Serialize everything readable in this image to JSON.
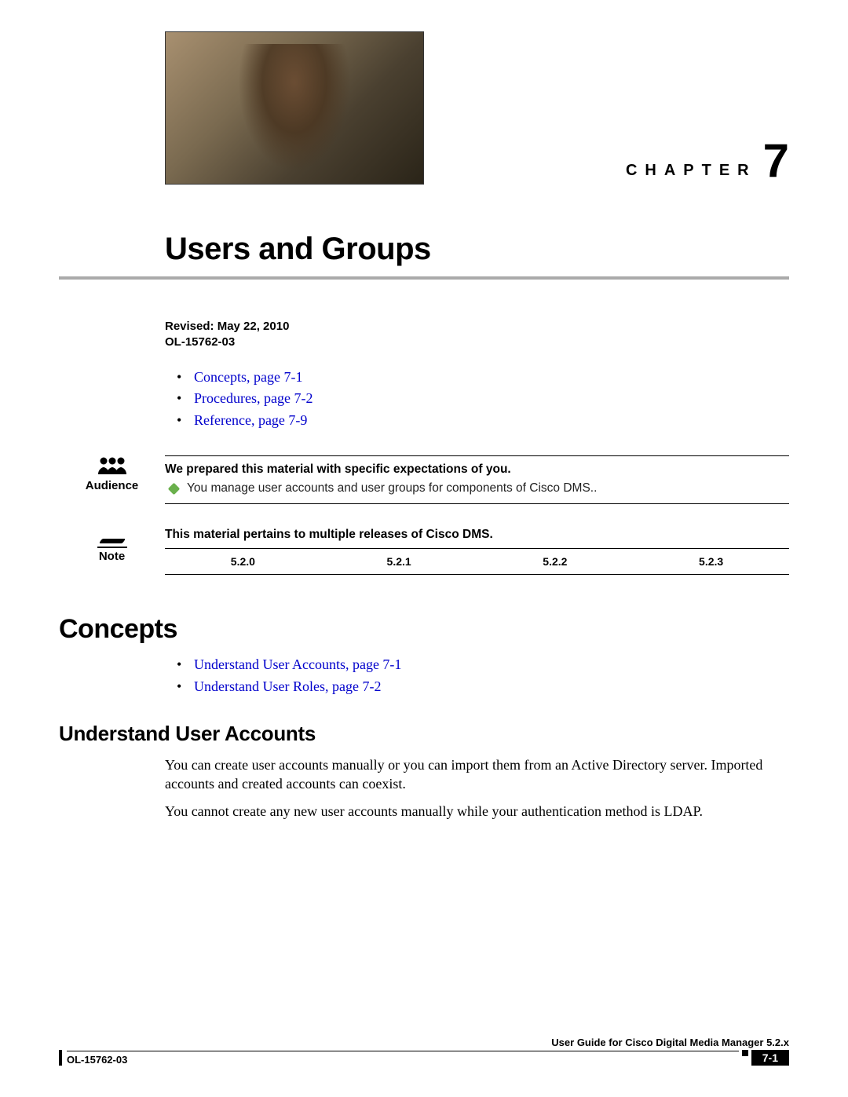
{
  "chapter": {
    "word": "CHAPTER",
    "number": "7"
  },
  "title": "Users and Groups",
  "meta": {
    "revised": "Revised: May 22, 2010",
    "ol": "OL-15762-03"
  },
  "top_links": [
    "Concepts, page 7-1",
    "Procedures, page 7-2",
    "Reference, page 7-9"
  ],
  "audience": {
    "label": "Audience",
    "headline": "We prepared this material with specific expectations of you.",
    "bullet": "You manage user accounts and user groups for components of Cisco DMS.."
  },
  "note": {
    "label": "Note",
    "headline": "This material pertains to multiple releases of Cisco DMS.",
    "versions": [
      "5.2.0",
      "5.2.1",
      "5.2.2",
      "5.2.3"
    ]
  },
  "concepts": {
    "heading": "Concepts",
    "links": [
      "Understand User Accounts, page 7-1",
      "Understand User Roles, page 7-2"
    ]
  },
  "ua": {
    "heading": "Understand User Accounts",
    "p1": "You can create user accounts manually or you can import them from an Active Directory server. Imported accounts and created accounts can coexist.",
    "p2": "You cannot create any new user accounts manually while your authentication method is LDAP."
  },
  "footer": {
    "guide": "User Guide for Cisco Digital Media Manager 5.2.x",
    "ol": "OL-15762-03",
    "page": "7-1"
  }
}
